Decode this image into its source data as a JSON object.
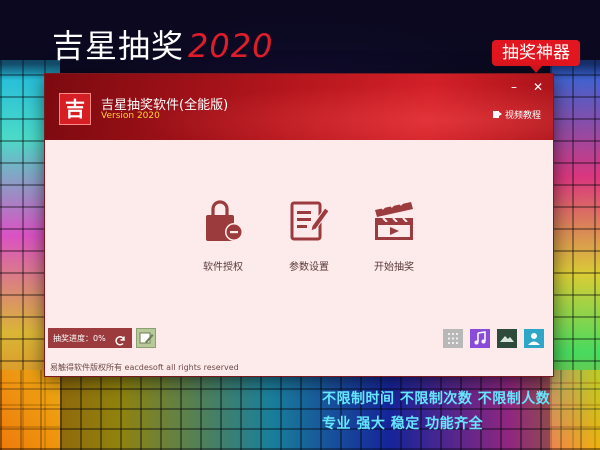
{
  "promo": {
    "title": "吉星抽奖",
    "year": "2020",
    "tag": "抽奖神器",
    "slogan_line1": "不限制时间  不限制次数  不限制人数",
    "slogan_line2": "专业 强大 稳定 功能齐全"
  },
  "window": {
    "logo_char": "吉",
    "app_name": "吉星抽奖软件(全能版)",
    "version": "Version 2020",
    "minimize_label": "–",
    "close_label": "✕",
    "video_tutorial": "视频教程"
  },
  "features": [
    {
      "label": "软件授权",
      "icon": "lock-license-icon"
    },
    {
      "label": "参数设置",
      "icon": "settings-document-icon"
    },
    {
      "label": "开始抽奖",
      "icon": "clapperboard-icon"
    }
  ],
  "progress": {
    "label": "抽奖进度：0%",
    "value": 0
  },
  "footer": {
    "copyright": "易触得软件版权所有 eacdesoft all rights reserved"
  },
  "colors": {
    "accent": "#d32028",
    "window_bg": "#fdeaea",
    "icon_color": "#9b3b3e",
    "slogan": "#66e6ff"
  }
}
